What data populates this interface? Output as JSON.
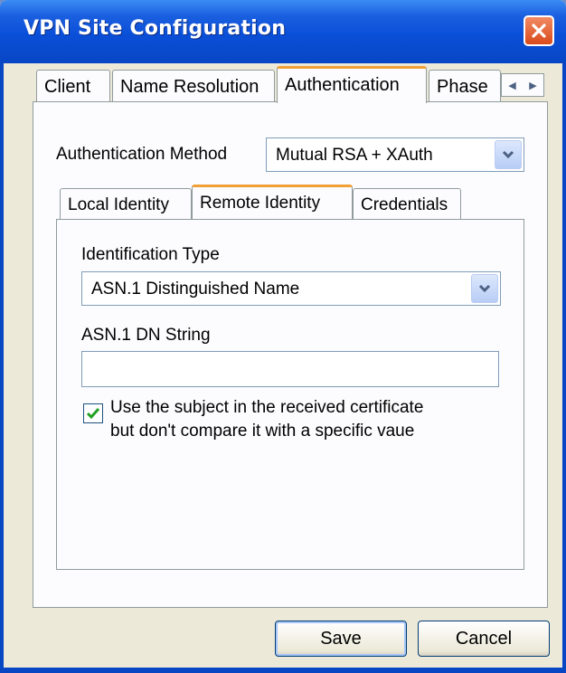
{
  "window": {
    "title": "VPN Site Configuration"
  },
  "tabs": [
    {
      "label": "Client"
    },
    {
      "label": "Name Resolution"
    },
    {
      "label": "Authentication"
    },
    {
      "label": "Phase"
    }
  ],
  "authentication": {
    "method_label": "Authentication Method",
    "method_value": "Mutual RSA + XAuth",
    "subtabs": [
      {
        "label": "Local Identity"
      },
      {
        "label": "Remote Identity"
      },
      {
        "label": "Credentials"
      }
    ],
    "remote_identity": {
      "identification_type_label": "Identification Type",
      "identification_type_value": "ASN.1 Distinguished Name",
      "dn_string_label": "ASN.1 DN String",
      "dn_string_value": "",
      "checkbox_checked": true,
      "checkbox_line1": "Use the subject in the received certificate",
      "checkbox_line2": "but don't compare it with a specific vaue"
    }
  },
  "buttons": {
    "save": "Save",
    "cancel": "Cancel"
  },
  "icons": {
    "close": "close-icon",
    "dropdown": "chevron-down-icon",
    "scroll_left": "arrow-left-icon",
    "scroll_right": "arrow-right-icon",
    "check": "checkmark-icon"
  },
  "colors": {
    "titlebar": "#0a4fd8",
    "tab_highlight": "#f0a035",
    "close": "#d94a1b",
    "dialog": "#ECE9D8"
  }
}
